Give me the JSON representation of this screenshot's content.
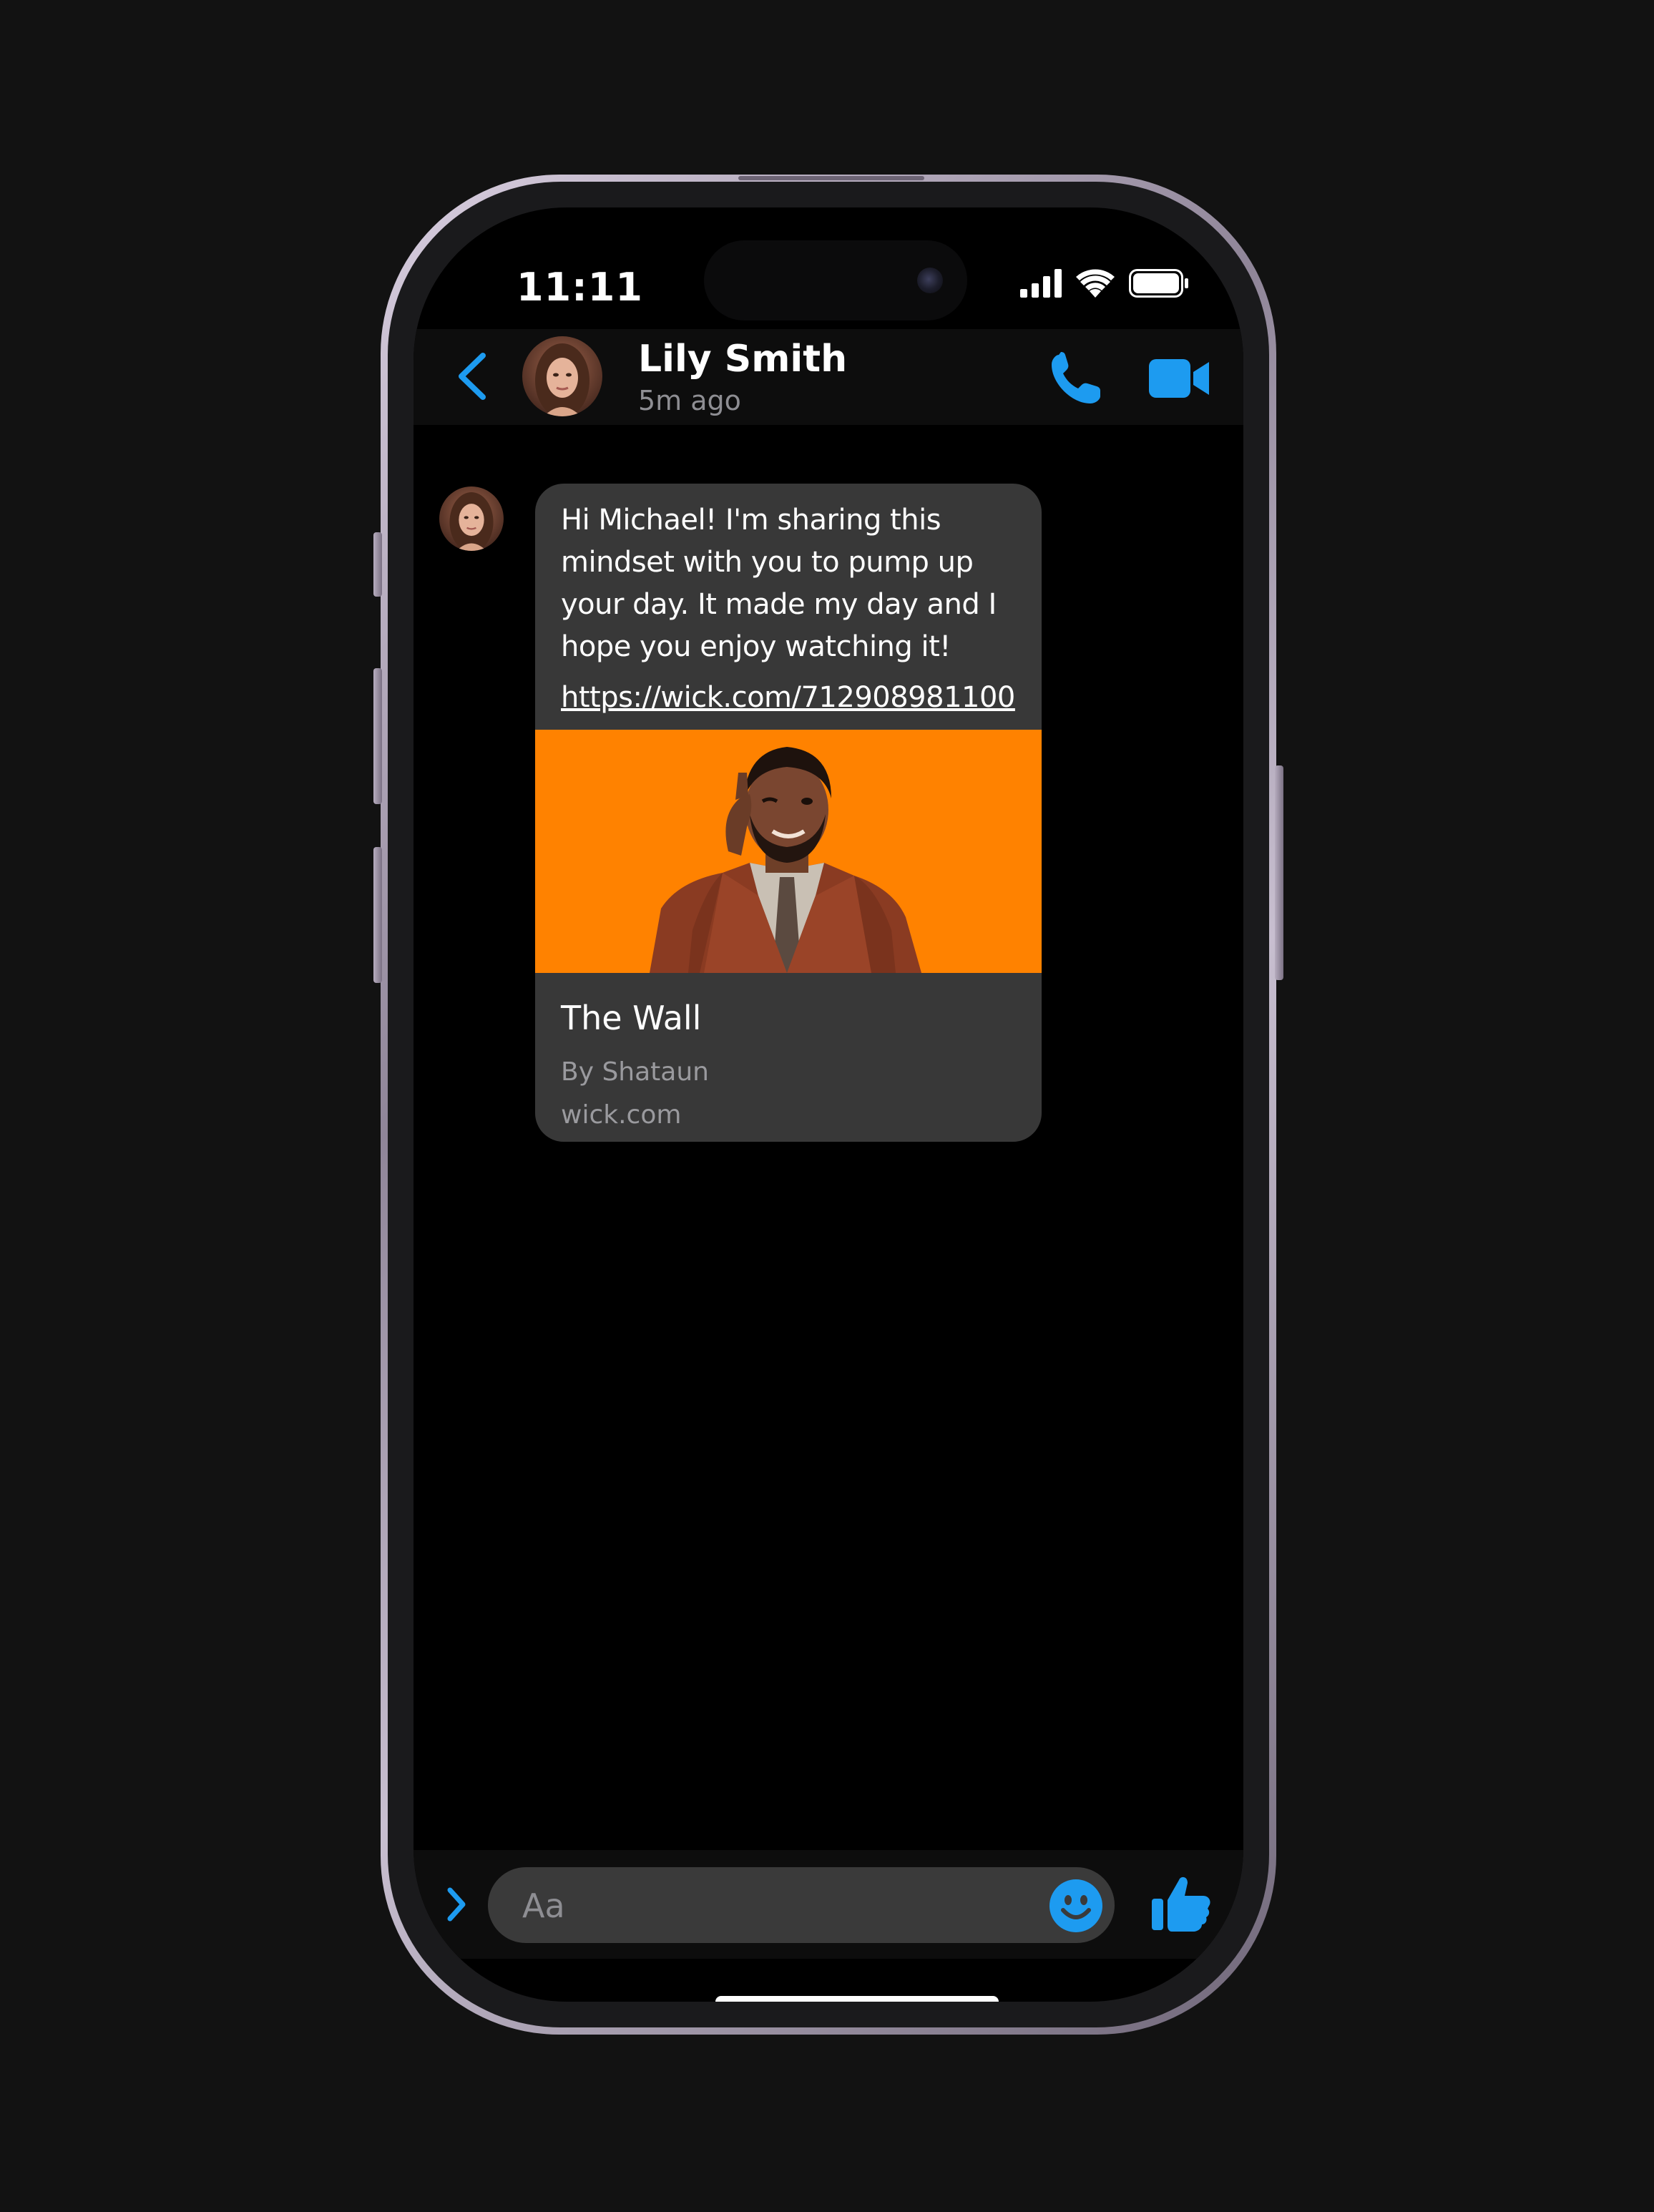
{
  "status_bar": {
    "time": "11:11"
  },
  "header": {
    "contact_name": "Lily Smith",
    "contact_status": "5m ago"
  },
  "message": {
    "text": "Hi Michael! I'm sharing this mindset with you to pump up your day. It made my day and I hope you enjoy watching it!",
    "link": "https://wick.com/712908981100",
    "preview": {
      "title": "The Wall",
      "author": "By Shataun",
      "domain": "wick.com"
    }
  },
  "composer": {
    "placeholder": "Aa"
  },
  "colors": {
    "accent": "#1d9bf0",
    "bubble": "#383838",
    "preview_background": "#ff8200",
    "secondary_text": "#8e8e93"
  },
  "icons": {
    "back": "chevron-left-icon",
    "call": "phone-icon",
    "video": "video-camera-icon",
    "expand": "chevron-right-icon",
    "emoji": "smiley-icon",
    "like": "thumbs-up-icon"
  }
}
